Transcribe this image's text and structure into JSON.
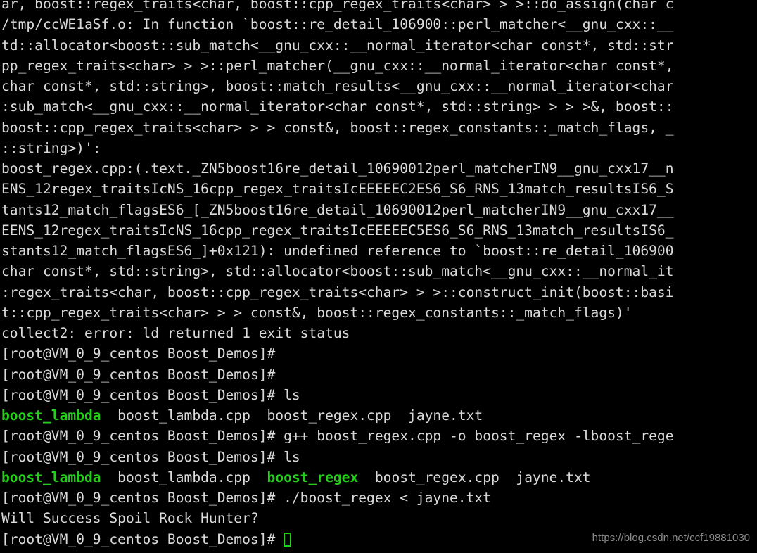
{
  "terminal": {
    "title": "Boost_Demos terminal session",
    "background_color": "#000000",
    "foreground_color": "#dadada",
    "green_color": "#23d018",
    "cursor": {
      "style": "hollow-box",
      "color": "#23d018"
    },
    "prompt": "[root@VM_0_9_centos Boost_Demos]#",
    "lines": [
      {
        "id": "line-01",
        "segments": [
          {
            "text": "ar, boost::regex_traits<char, boost::cpp_regex_traits<char> > >::do_assign(char c",
            "color": "default"
          }
        ]
      },
      {
        "id": "line-02",
        "segments": [
          {
            "text": "/tmp/ccWE1aSf.o: In function `boost::re_detail_106900::perl_matcher<__gnu_cxx::__",
            "color": "default"
          }
        ]
      },
      {
        "id": "line-03",
        "segments": [
          {
            "text": "td::allocator<boost::sub_match<__gnu_cxx::__normal_iterator<char const*, std::str",
            "color": "default"
          }
        ]
      },
      {
        "id": "line-04",
        "segments": [
          {
            "text": "pp_regex_traits<char> > >::perl_matcher(__gnu_cxx::__normal_iterator<char const*,",
            "color": "default"
          }
        ]
      },
      {
        "id": "line-05",
        "segments": [
          {
            "text": "char const*, std::string>, boost::match_results<__gnu_cxx::__normal_iterator<char",
            "color": "default"
          }
        ]
      },
      {
        "id": "line-06",
        "segments": [
          {
            "text": ":sub_match<__gnu_cxx::__normal_iterator<char const*, std::string> > > >&, boost::",
            "color": "default"
          }
        ]
      },
      {
        "id": "line-07",
        "segments": [
          {
            "text": "boost::cpp_regex_traits<char> > > const&, boost::regex_constants::_match_flags, _",
            "color": "default"
          }
        ]
      },
      {
        "id": "line-08",
        "segments": [
          {
            "text": "::string>)':",
            "color": "default"
          }
        ]
      },
      {
        "id": "line-09",
        "segments": [
          {
            "text": "boost_regex.cpp:(.text._ZN5boost16re_detail_10690012perl_matcherIN9__gnu_cxx17__n",
            "color": "default"
          }
        ]
      },
      {
        "id": "line-10",
        "segments": [
          {
            "text": "ENS_12regex_traitsIcNS_16cpp_regex_traitsIcEEEEEC2ES6_S6_RNS_13match_resultsIS6_S",
            "color": "default"
          }
        ]
      },
      {
        "id": "line-11",
        "segments": [
          {
            "text": "tants12_match_flagsES6_[_ZN5boost16re_detail_10690012perl_matcherIN9__gnu_cxx17__",
            "color": "default"
          }
        ]
      },
      {
        "id": "line-12",
        "segments": [
          {
            "text": "EENS_12regex_traitsIcNS_16cpp_regex_traitsIcEEEEEC5ES6_S6_RNS_13match_resultsIS6_",
            "color": "default"
          }
        ]
      },
      {
        "id": "line-13",
        "segments": [
          {
            "text": "stants12_match_flagsES6_]+0x121): undefined reference to `boost::re_detail_106900",
            "color": "default"
          }
        ]
      },
      {
        "id": "line-14",
        "segments": [
          {
            "text": "char const*, std::string>, std::allocator<boost::sub_match<__gnu_cxx::__normal_it",
            "color": "default"
          }
        ]
      },
      {
        "id": "line-15",
        "segments": [
          {
            "text": ":regex_traits<char, boost::cpp_regex_traits<char> > >::construct_init(boost::basi",
            "color": "default"
          }
        ]
      },
      {
        "id": "line-16",
        "segments": [
          {
            "text": "t::cpp_regex_traits<char> > > const&, boost::regex_constants::_match_flags)'",
            "color": "default"
          }
        ]
      },
      {
        "id": "line-17",
        "segments": [
          {
            "text": "collect2: error: ld returned 1 exit status",
            "color": "default"
          }
        ]
      },
      {
        "id": "line-18",
        "segments": [
          {
            "text": "[root@VM_0_9_centos Boost_Demos]#",
            "color": "default"
          }
        ]
      },
      {
        "id": "line-19",
        "segments": [
          {
            "text": "[root@VM_0_9_centos Boost_Demos]#",
            "color": "default"
          }
        ]
      },
      {
        "id": "line-20",
        "segments": [
          {
            "text": "[root@VM_0_9_centos Boost_Demos]# ls",
            "color": "default"
          }
        ]
      },
      {
        "id": "line-21",
        "segments": [
          {
            "text": "boost_lambda",
            "color": "green"
          },
          {
            "text": "  boost_lambda.cpp  boost_regex.cpp  jayne.txt",
            "color": "default"
          }
        ]
      },
      {
        "id": "line-22",
        "segments": [
          {
            "text": "[root@VM_0_9_centos Boost_Demos]# g++ boost_regex.cpp -o boost_regex -lboost_rege",
            "color": "default"
          }
        ]
      },
      {
        "id": "line-23",
        "segments": [
          {
            "text": "[root@VM_0_9_centos Boost_Demos]# ls",
            "color": "default"
          }
        ]
      },
      {
        "id": "line-24",
        "segments": [
          {
            "text": "boost_lambda",
            "color": "green"
          },
          {
            "text": "  boost_lambda.cpp  ",
            "color": "default"
          },
          {
            "text": "boost_regex",
            "color": "green"
          },
          {
            "text": "  boost_regex.cpp  jayne.txt",
            "color": "default"
          }
        ]
      },
      {
        "id": "line-25",
        "segments": [
          {
            "text": "[root@VM_0_9_centos Boost_Demos]# ./boost_regex < jayne.txt",
            "color": "default"
          }
        ]
      },
      {
        "id": "line-26",
        "segments": [
          {
            "text": "Will Success Spoil Rock Hunter?",
            "color": "default"
          }
        ]
      },
      {
        "id": "line-27",
        "segments": [
          {
            "text": "[root@VM_0_9_centos Boost_Demos]# ",
            "color": "default"
          }
        ],
        "cursor": true
      }
    ]
  },
  "watermark": {
    "text": "https://blog.csdn.net/ccf19881030"
  }
}
